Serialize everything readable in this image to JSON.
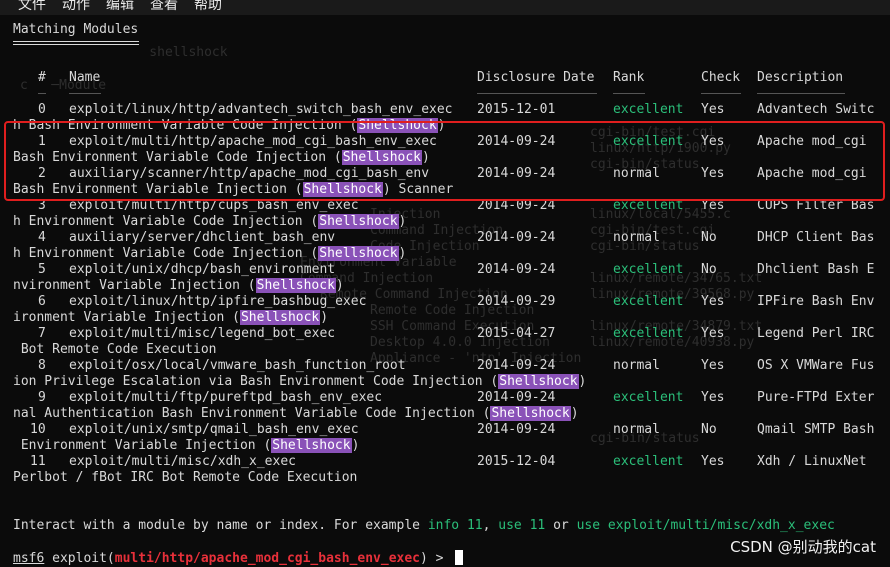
{
  "menu": [
    "文件",
    "动作",
    "编辑",
    "查看",
    "帮助"
  ],
  "title": "Matching Modules",
  "headers": {
    "num": "#",
    "name": "Name",
    "date": "Disclosure Date",
    "rank": "Rank",
    "check": "Check",
    "desc": "Description"
  },
  "header_dashes": {
    "num": "-",
    "name": "----",
    "date": "---------------",
    "rank": "----",
    "check": "-----",
    "desc": "-----------"
  },
  "ghost_text": [
    "    shellshock",
    "c   ─Module",
    "cgi-bin/test.cgi",
    "linux/http/1900.py",
    "cgi-bin/status",
    "Injection",
    "Command Injection",
    "Code Injection",
    "linux/local/5455.c",
    "cgi-bin/test.cgi",
    "cgi-bin/status",
    "Environment Variable",
    "Command Injection",
    "Remote Command Injection",
    "linux/remote/34765.txt",
    "linux/remote/39568.py",
    "Remote Code Injection",
    "SSH Command Execution",
    "Desktop 4.0.0 Injection",
    "Appliance - 'ntp' Injection",
    "linux/remote/34879.txt",
    "linux/remote/40938.py",
    "cgi-bin/status"
  ],
  "modules": [
    {
      "num": "0",
      "name": "exploit/linux/http/advantech_switch_bash_env_exec",
      "date": "2015-12-01",
      "rank": "excellent",
      "check": "Yes",
      "desc": "Advantech Switc",
      "cont_pre": "h Bash Environment Variable Code Injection (",
      "cont_hl": "Shellshock",
      "cont_post": ")"
    },
    {
      "num": "1",
      "name": "exploit/multi/http/apache_mod_cgi_bash_env_exec",
      "date": "2014-09-24",
      "rank": "excellent",
      "check": "Yes",
      "desc": "Apache mod_cgi",
      "cont_pre": "Bash Environment Variable Code Injection (",
      "cont_hl": "Shellshock",
      "cont_post": ")"
    },
    {
      "num": "2",
      "name": "auxiliary/scanner/http/apache_mod_cgi_bash_env",
      "date": "2014-09-24",
      "rank": "normal",
      "check": "Yes",
      "desc": "Apache mod_cgi",
      "cont_pre": "Bash Environment Variable Injection (",
      "cont_hl": "Shellshock",
      "cont_post": ") Scanner"
    },
    {
      "num": "3",
      "name": "exploit/multi/http/cups_bash_env_exec",
      "date": "2014-09-24",
      "rank": "excellent",
      "check": "Yes",
      "desc": "CUPS Filter Bas",
      "cont_pre": "h Environment Variable Code Injection (",
      "cont_hl": "Shellshock",
      "cont_post": ")"
    },
    {
      "num": "4",
      "name": "auxiliary/server/dhclient_bash_env",
      "date": "2014-09-24",
      "rank": "normal",
      "check": "No",
      "desc": "DHCP Client Bas",
      "cont_pre": "h Environment Variable Code Injection (",
      "cont_hl": "Shellshock",
      "cont_post": ")"
    },
    {
      "num": "5",
      "name": "exploit/unix/dhcp/bash_environment",
      "date": "2014-09-24",
      "rank": "excellent",
      "check": "No",
      "desc": "Dhclient Bash E",
      "cont_pre": "nvironment Variable Injection (",
      "cont_hl": "Shellshock",
      "cont_post": ")"
    },
    {
      "num": "6",
      "name": "exploit/linux/http/ipfire_bashbug_exec",
      "date": "2014-09-29",
      "rank": "excellent",
      "check": "Yes",
      "desc": "IPFire Bash Env",
      "cont_pre": "ironment Variable Injection (",
      "cont_hl": "Shellshock",
      "cont_post": ")"
    },
    {
      "num": "7",
      "name": "exploit/multi/misc/legend_bot_exec",
      "date": "2015-04-27",
      "rank": "excellent",
      "check": "Yes",
      "desc": "Legend Perl IRC",
      "cont_pre": " Bot Remote Code Execution",
      "cont_hl": "",
      "cont_post": ""
    },
    {
      "num": "8",
      "name": "exploit/osx/local/vmware_bash_function_root",
      "date": "2014-09-24",
      "rank": "normal",
      "check": "Yes",
      "desc": "OS X VMWare Fus",
      "cont_pre": "ion Privilege Escalation via Bash Environment Code Injection (",
      "cont_hl": "Shellshock",
      "cont_post": ")"
    },
    {
      "num": "9",
      "name": "exploit/multi/ftp/pureftpd_bash_env_exec",
      "date": "2014-09-24",
      "rank": "excellent",
      "check": "Yes",
      "desc": "Pure-FTPd Exter",
      "cont_pre": "nal Authentication Bash Environment Variable Code Injection (",
      "cont_hl": "Shellshock",
      "cont_post": ")"
    },
    {
      "num": "10",
      "name": "exploit/unix/smtp/qmail_bash_env_exec",
      "date": "2014-09-24",
      "rank": "normal",
      "check": "No",
      "desc": "Qmail SMTP Bash",
      "cont_pre": " Environment Variable Injection (",
      "cont_hl": "Shellshock",
      "cont_post": ")"
    },
    {
      "num": "11",
      "name": "exploit/multi/misc/xdh_x_exec",
      "date": "2015-12-04",
      "rank": "excellent",
      "check": "Yes",
      "desc": "Xdh / LinuxNet",
      "cont_pre": "Perlbot / fBot IRC Bot Remote Code Execution",
      "cont_hl": "",
      "cont_post": ""
    }
  ],
  "interact": {
    "prefix": "Interact with a module by name or index. For example ",
    "info": "info 11",
    "sep1": ", ",
    "use_idx": "use 11",
    "sep2": " or ",
    "use_path": "use exploit/multi/misc/xdh_x_exec"
  },
  "prompt": {
    "msf": "msf6",
    "pre": " exploit(",
    "module": "multi/http/apache_mod_cgi_bash_env_exec",
    "post": ") > "
  },
  "watermark": "CSDN @别动我的cat",
  "colors": {
    "accent_green": "#2bbf7a",
    "highlight": "#8a52b8",
    "prompt_red": "#e8303a",
    "selection_border": "#e01e1e"
  }
}
